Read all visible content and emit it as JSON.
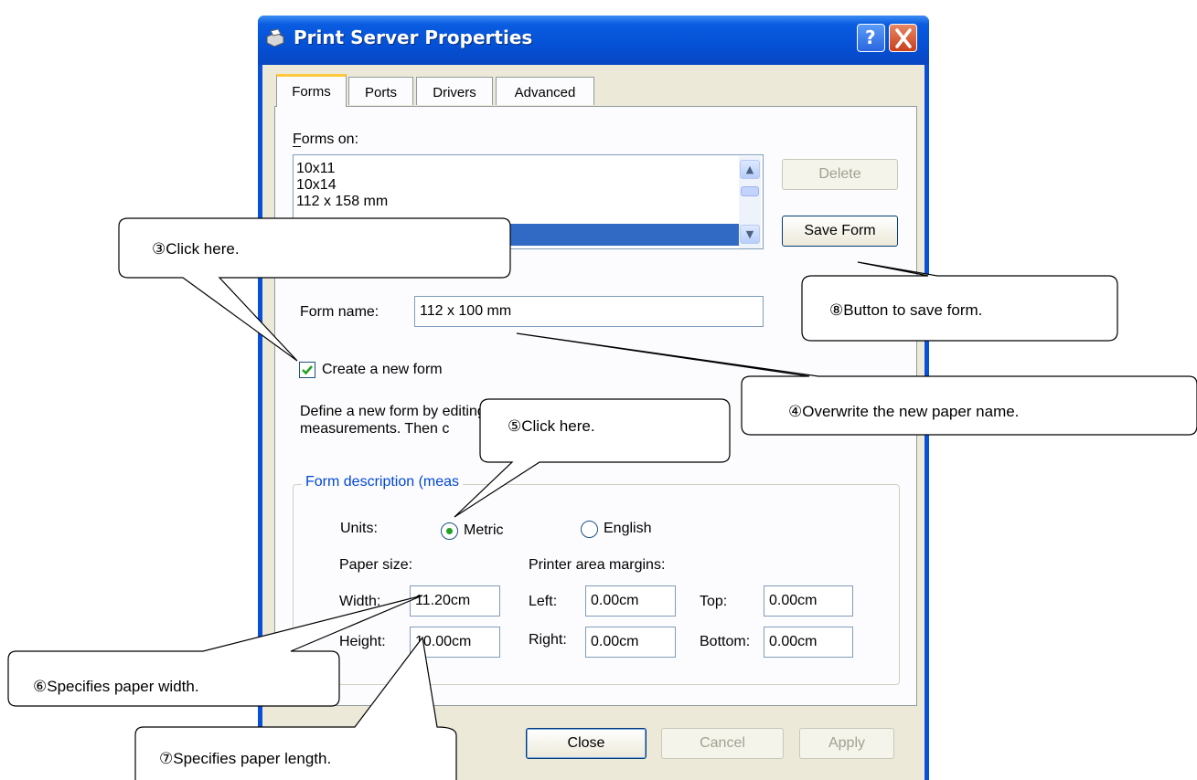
{
  "window": {
    "title": "Print Server Properties",
    "help_button": "?",
    "close_button": "X"
  },
  "tabs": [
    {
      "label": "Forms"
    },
    {
      "label": "Ports"
    },
    {
      "label": "Drivers"
    },
    {
      "label": "Advanced"
    }
  ],
  "forms_tab": {
    "forms_on_label": "Forms on:",
    "forms_list": [
      "10x11",
      "10x14",
      "112 x 158 mm"
    ],
    "delete_button": "Delete",
    "save_form_button": "Save Form",
    "form_name_label": "Form name:",
    "form_name_value": "112 x 100 mm",
    "create_new_form": {
      "label": "Create a new form",
      "checked": true
    },
    "description_line1": "Define a new form by editing the existing name and",
    "description_line2": "measurements.  Then c",
    "group_title": "Form description (meas",
    "units_label": "Units:",
    "units": [
      {
        "label": "Metric",
        "selected": true
      },
      {
        "label": "English",
        "selected": false
      }
    ],
    "paper_size_label": "Paper size:",
    "margins_label": "Printer area margins:",
    "width_label": "Width:",
    "width_value": "11.20cm",
    "height_label": "Height:",
    "height_value": "10.00cm",
    "left_label": "Left:",
    "left_value": "0.00cm",
    "right_label": "Right:",
    "right_value": "0.00cm",
    "top_label": "Top:",
    "top_value": "0.00cm",
    "bottom_label": "Bottom:",
    "bottom_value": "0.00cm"
  },
  "footer": {
    "close_button": "Close",
    "cancel_button": "Cancel",
    "apply_button": "Apply"
  },
  "callouts": {
    "c3": "③Click here.",
    "c4": "④Overwrite the new paper name.",
    "c5": "⑤Click here.",
    "c6": "⑥Specifies paper width.",
    "c7": "⑦Specifies paper length.",
    "c8": "⑧Button to save form."
  },
  "colors": {
    "titlebar": "#0551d6",
    "selection": "#316ac5",
    "tab_highlight": "#ffc73c",
    "group_title": "#0046d5"
  }
}
